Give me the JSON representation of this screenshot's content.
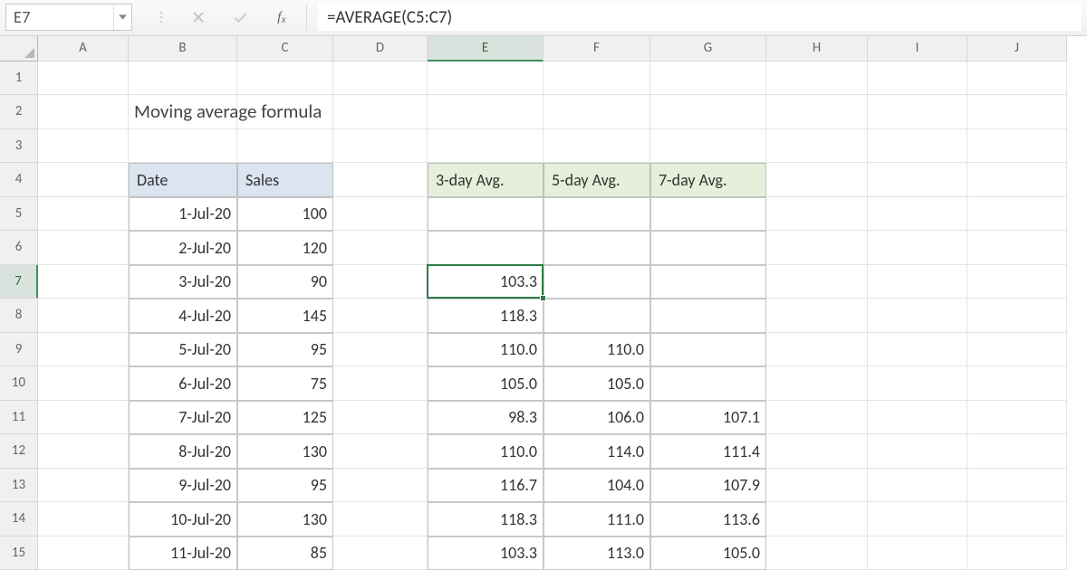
{
  "active_cell_ref": "E7",
  "formula_bar": "=AVERAGE(C5:C7)",
  "columns": [
    "A",
    "B",
    "C",
    "D",
    "E",
    "F",
    "G",
    "H",
    "I",
    "J"
  ],
  "row_count": 15,
  "active_col_index": 4,
  "active_row_index": 6,
  "title": "Moving average formula",
  "table1": {
    "headers": [
      "Date",
      "Sales"
    ],
    "rows": [
      [
        "1-Jul-20",
        "100"
      ],
      [
        "2-Jul-20",
        "120"
      ],
      [
        "3-Jul-20",
        "90"
      ],
      [
        "4-Jul-20",
        "145"
      ],
      [
        "5-Jul-20",
        "95"
      ],
      [
        "6-Jul-20",
        "75"
      ],
      [
        "7-Jul-20",
        "125"
      ],
      [
        "8-Jul-20",
        "130"
      ],
      [
        "9-Jul-20",
        "95"
      ],
      [
        "10-Jul-20",
        "130"
      ],
      [
        "11-Jul-20",
        "85"
      ]
    ]
  },
  "table2": {
    "headers": [
      "3-day Avg.",
      "5-day Avg.",
      "7-day Avg."
    ],
    "rows": [
      [
        "",
        "",
        ""
      ],
      [
        "",
        "",
        ""
      ],
      [
        "103.3",
        "",
        ""
      ],
      [
        "118.3",
        "",
        ""
      ],
      [
        "110.0",
        "110.0",
        ""
      ],
      [
        "105.0",
        "105.0",
        ""
      ],
      [
        "98.3",
        "106.0",
        "107.1"
      ],
      [
        "110.0",
        "114.0",
        "111.4"
      ],
      [
        "116.7",
        "104.0",
        "107.9"
      ],
      [
        "118.3",
        "111.0",
        "113.6"
      ],
      [
        "103.3",
        "113.0",
        "105.0"
      ]
    ]
  }
}
